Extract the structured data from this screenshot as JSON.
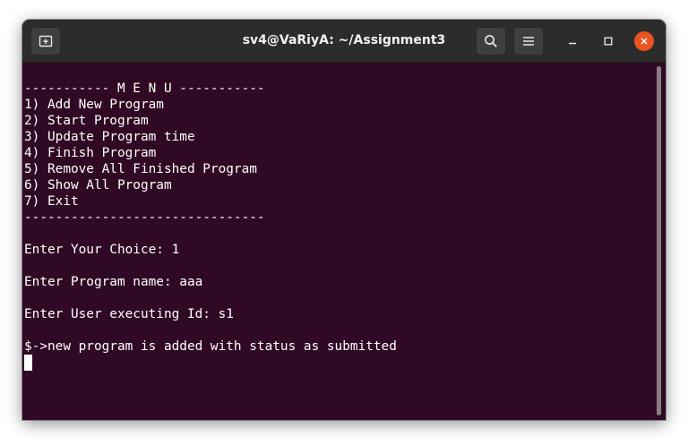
{
  "window": {
    "title": "sv4@VaRiyA: ~/Assignment3"
  },
  "titlebar": {
    "icons": {
      "new_tab": "new-tab-icon",
      "search": "search-icon",
      "menu": "hamburger-menu-icon",
      "minimize": "minimize-icon",
      "maximize": "maximize-icon",
      "close": "close-icon"
    },
    "close_color": "#e95420"
  },
  "terminal": {
    "background": "#300a24",
    "foreground": "#ffffff",
    "lines": [
      "----------- M E N U -----------",
      "1) Add New Program",
      "2) Start Program",
      "3) Update Program time",
      "4) Finish Program",
      "5) Remove All Finished Program",
      "6) Show All Program",
      "7) Exit",
      "-------------------------------",
      "",
      "Enter Your Choice: 1",
      "",
      "Enter Program name: aaa",
      "",
      "Enter User executing Id: s1",
      "",
      "$->new program is added with status as submitted"
    ]
  }
}
